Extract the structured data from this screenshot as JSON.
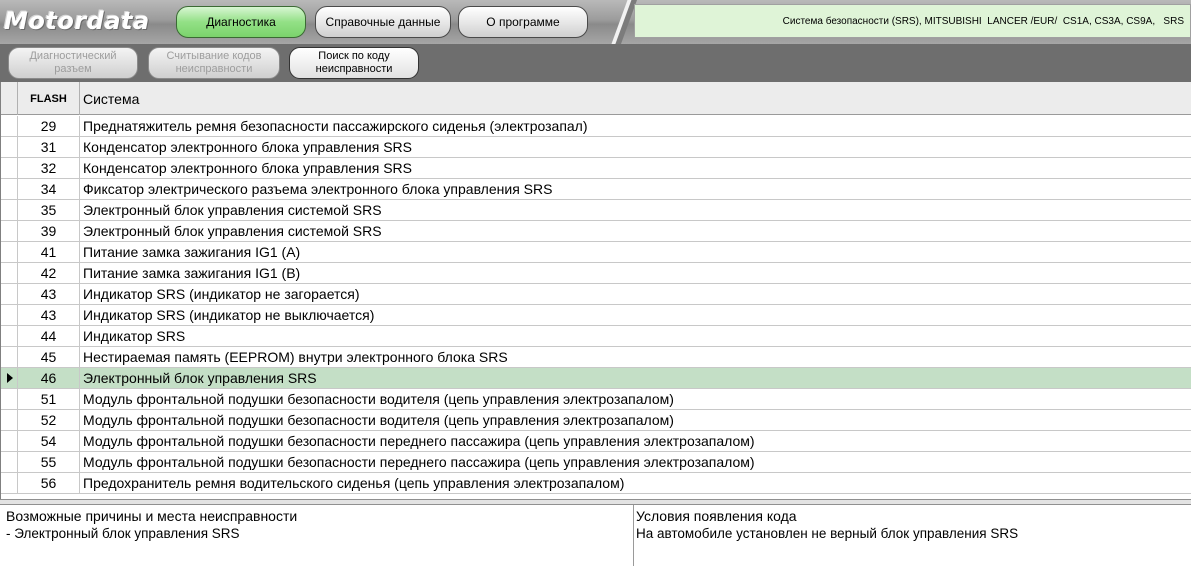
{
  "app": {
    "logo": "Motordata"
  },
  "nav": {
    "tabs": [
      {
        "label": "Диагностика",
        "active": true
      },
      {
        "label": "Справочные данные",
        "active": false
      },
      {
        "label": "О программе",
        "active": false
      }
    ],
    "vehicle_info": "Система безопасности (SRS), MITSUBISHI  LANCER /EUR/  CS1A, CS3A, CS9A,   SRS"
  },
  "toolbar": {
    "buttons": [
      {
        "label": "Диагностический\nразъем",
        "enabled": false
      },
      {
        "label": "Считывание кодов\nнеисправности",
        "enabled": false
      },
      {
        "label": "Поиск по коду\nнеисправности",
        "enabled": true
      }
    ]
  },
  "grid": {
    "headers": {
      "flash": "FLASH",
      "system": "Система"
    },
    "selected_index": 12,
    "rows": [
      {
        "code": "29",
        "desc": "Преднатяжитель ремня безопасности пассажирского сиденья (электрозапал)"
      },
      {
        "code": "31",
        "desc": "Конденсатор электронного блока управления SRS"
      },
      {
        "code": "32",
        "desc": "Конденсатор электронного блока управления SRS"
      },
      {
        "code": "34",
        "desc": "Фиксатор электрического разъема электронного блока управления SRS"
      },
      {
        "code": "35",
        "desc": "Электронный блок управления системой SRS"
      },
      {
        "code": "39",
        "desc": "Электронный блок управления системой SRS"
      },
      {
        "code": "41",
        "desc": "Питание замка зажигания IG1 (A)"
      },
      {
        "code": "42",
        "desc": "Питание замка зажигания IG1 (B)"
      },
      {
        "code": "43",
        "desc": "Индикатор SRS (индикатор не загорается)"
      },
      {
        "code": "43",
        "desc": "Индикатор SRS (индикатор не выключается)"
      },
      {
        "code": "44",
        "desc": "Индикатор SRS"
      },
      {
        "code": "45",
        "desc": "Нестираемая память (EEPROM) внутри электронного блока SRS"
      },
      {
        "code": "46",
        "desc": "Электронный блок управления SRS"
      },
      {
        "code": "51",
        "desc": "Модуль фронтальной подушки безопасности водителя (цепь управления электрозапалом)"
      },
      {
        "code": "52",
        "desc": "Модуль фронтальной подушки безопасности водителя (цепь управления электрозапалом)"
      },
      {
        "code": "54",
        "desc": "Модуль фронтальной подушки безопасности переднего пассажира (цепь управления электрозапалом)"
      },
      {
        "code": "55",
        "desc": "Модуль фронтальной подушки безопасности переднего пассажира (цепь управления электрозапалом)"
      },
      {
        "code": "56",
        "desc": "Предохранитель ремня водительского сиденья (цепь управления электрозапалом)"
      }
    ]
  },
  "details": {
    "causes_title": "Возможные причины и места неисправности",
    "causes_text": "- Электронный блок управления SRS",
    "conditions_title": "Условия появления кода",
    "conditions_text": "На автомобиле установлен не верный блок управления SRS"
  },
  "colors": {
    "active_tab": "#7bd36c",
    "selected_row": "#c4dfc6",
    "info_strip": "#dff4d7"
  }
}
